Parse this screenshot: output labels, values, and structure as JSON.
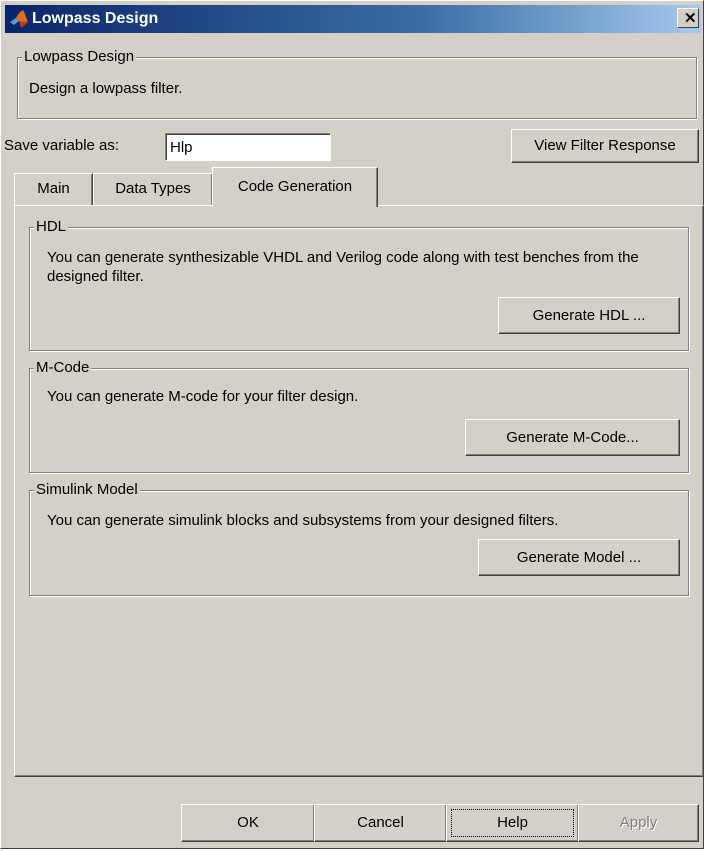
{
  "window": {
    "title": "Lowpass Design",
    "close_symbol": "✕",
    "icon": "matlab-logo-icon"
  },
  "header_group": {
    "label": "Lowpass Design",
    "description": "Design a lowpass filter."
  },
  "save_variable": {
    "label": "Save variable as:",
    "value": "Hlp"
  },
  "view_filter_response_label": "View Filter Response",
  "tabs": [
    {
      "label": "Main",
      "active": false
    },
    {
      "label": "Data Types",
      "active": false
    },
    {
      "label": "Code Generation",
      "active": true
    }
  ],
  "code_generation": {
    "hdl": {
      "label": "HDL",
      "description": "You can generate synthesizable VHDL and Verilog code along with test benches from the designed filter.",
      "button_label": "Generate HDL ..."
    },
    "mcode": {
      "label": "M-Code",
      "description": "You can generate M-code for your filter design.",
      "button_label": "Generate M-Code..."
    },
    "simulink": {
      "label": "Simulink Model",
      "description": "You can generate simulink blocks and subsystems from your designed filters.",
      "button_label": "Generate Model ..."
    }
  },
  "footer": {
    "ok_label": "OK",
    "cancel_label": "Cancel",
    "help_label": "Help",
    "apply_label": "Apply",
    "apply_enabled": false
  },
  "colors": {
    "dialog_background": "#d4d0c8",
    "titlebar_start": "#0a246a",
    "titlebar_end": "#a6caf0",
    "title_text": "#ffffff",
    "disabled_text": "#808080"
  }
}
